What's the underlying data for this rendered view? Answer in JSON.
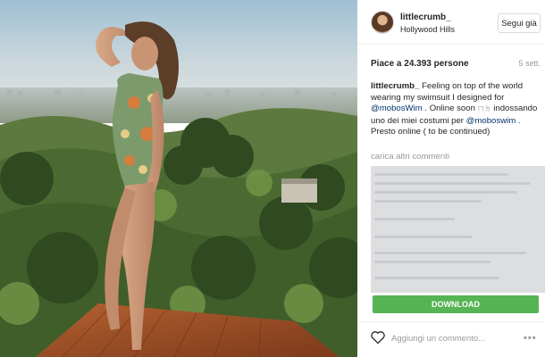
{
  "header": {
    "username": "littlecrumb_",
    "location": "Hollywood Hills",
    "follow_label": "Segui già"
  },
  "post": {
    "likes": "Piace a 24.393 persone",
    "age": "5 sett.",
    "caption": {
      "user": "littlecrumb_",
      "text_1": " Feeling on top of the world wearing my swimsuit I designed for ",
      "mention_1": "@mobosWim",
      "text_2": " . Online soon ",
      "cjk": "ㄇㄉ",
      "text_3": " indossando uno dei miei costumi per ",
      "mention_2": "@moboswim",
      "text_4": " . Presto online ( to be continued)"
    },
    "load_more": "carica altri commenti"
  },
  "download": {
    "label": "DOWNLOAD"
  },
  "comment": {
    "placeholder": "Aggiungi un commento..."
  },
  "icons": {
    "like": "heart-icon",
    "more": "more-options-icon"
  },
  "colors": {
    "download_green": "#55b454",
    "mention_blue": "#003569",
    "muted": "#999999"
  }
}
